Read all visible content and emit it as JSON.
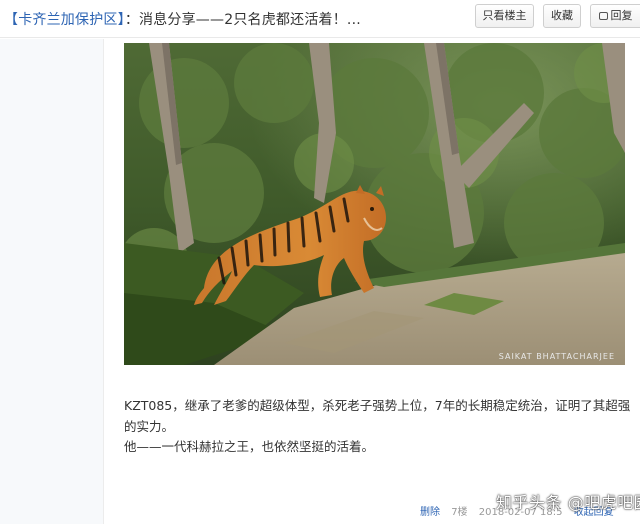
{
  "header": {
    "title_forum": "【卡齐兰加保护区】",
    "title_text": "：消息分享——2只名虎都还活着！...",
    "btn_louzhu": "只看楼主",
    "btn_shoucang": "收藏",
    "btn_reply": "回复"
  },
  "post": {
    "image_credit": "SAIKAT BHATTACHARJEE",
    "paragraph1": "KZT085，继承了老爹的超级体型，杀死老子强势上位，7年的长期稳定统治，证明了其超强的实力。",
    "paragraph2": "他——一代科赫拉之王，也依然坚挺的活着。",
    "footer": {
      "delete": "删除",
      "floor": "7楼",
      "time": "2018-02-07 18:5",
      "reply_link": "收起回复"
    }
  },
  "watermark": "知乎头条 @吧虎吧园"
}
